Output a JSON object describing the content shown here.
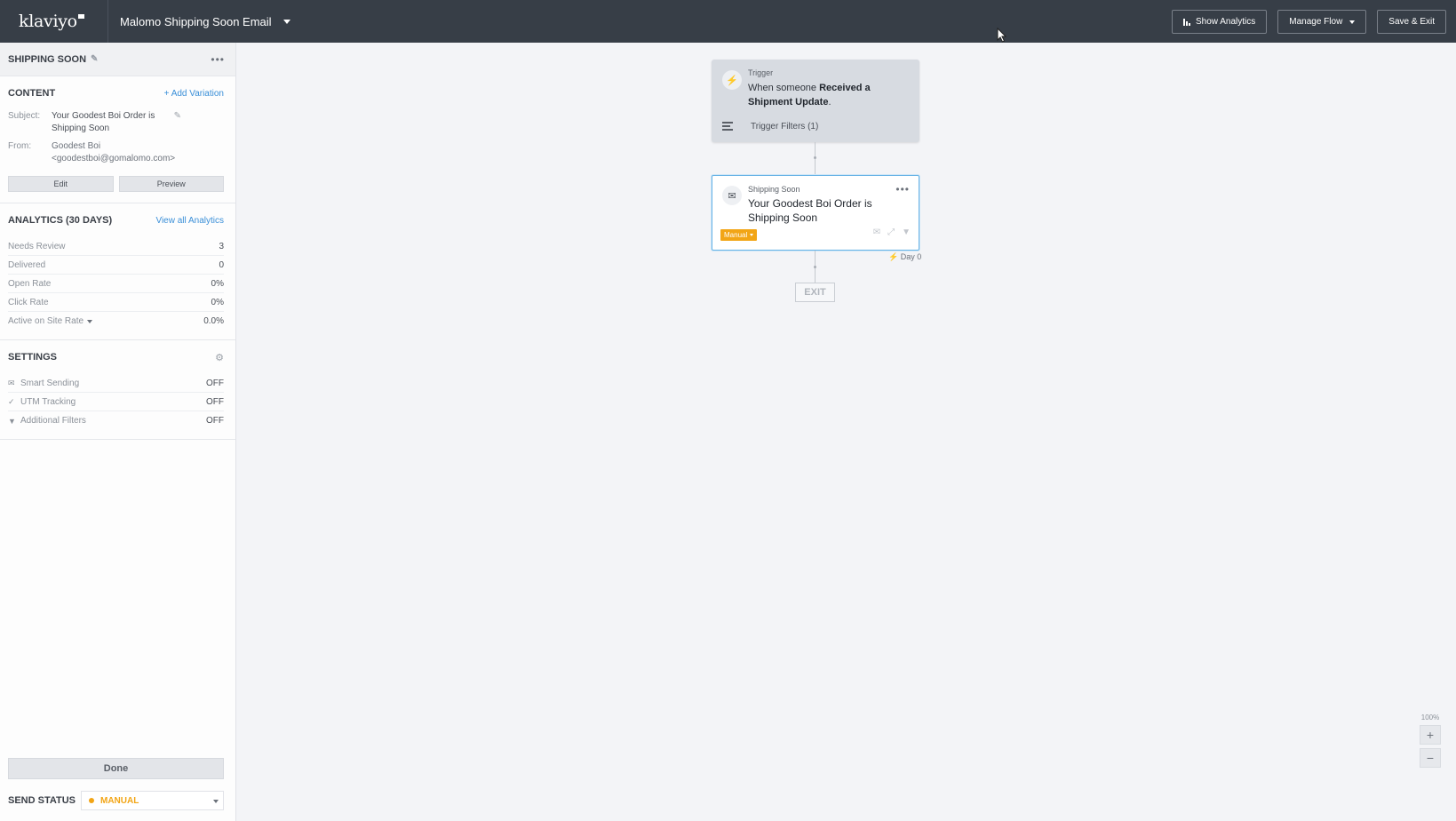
{
  "topbar": {
    "logo": "klaviyo",
    "flow_name": "Malomo Shipping Soon Email",
    "show_analytics": "Show Analytics",
    "manage_flow": "Manage Flow",
    "save_exit": "Save & Exit"
  },
  "sidebar": {
    "title": "SHIPPING SOON",
    "content": {
      "heading": "CONTENT",
      "add_variation": "+ Add Variation",
      "subject_label": "Subject:",
      "subject_value": "Your Goodest Boi Order is Shipping Soon",
      "from_label": "From:",
      "from_name": "Goodest Boi",
      "from_email": "<goodestboi@gomalomo.com>",
      "edit": "Edit",
      "preview": "Preview"
    },
    "analytics": {
      "heading": "ANALYTICS (30 DAYS)",
      "view_all": "View all Analytics",
      "rows": [
        {
          "label": "Needs Review",
          "value": "3"
        },
        {
          "label": "Delivered",
          "value": "0"
        },
        {
          "label": "Open Rate",
          "value": "0%"
        },
        {
          "label": "Click Rate",
          "value": "0%"
        },
        {
          "label": "Active on Site Rate",
          "value": "0.0%"
        }
      ]
    },
    "settings": {
      "heading": "SETTINGS",
      "rows": [
        {
          "label": "Smart Sending",
          "value": "OFF",
          "icon": "mail-check-icon"
        },
        {
          "label": "UTM Tracking",
          "value": "OFF",
          "icon": "check-icon"
        },
        {
          "label": "Additional Filters",
          "value": "OFF",
          "icon": "filter-icon"
        }
      ]
    },
    "done": "Done",
    "send_status_label": "SEND STATUS",
    "send_status_value": "MANUAL"
  },
  "canvas": {
    "trigger": {
      "kicker": "Trigger",
      "text_prefix": "When someone ",
      "text_bold": "Received a Shipment Update",
      "text_suffix": ".",
      "filters": "Trigger Filters (1)"
    },
    "email": {
      "kicker": "Shipping Soon",
      "title": "Your Goodest Boi Order is Shipping Soon",
      "badge": "Manual",
      "day": "Day 0"
    },
    "exit": "EXIT",
    "zoom": "100%",
    "zoom_in": "+",
    "zoom_out": "−"
  },
  "colors": {
    "topbar": "#373e47",
    "accent": "#3a8fd8",
    "manual": "#f2a516"
  }
}
